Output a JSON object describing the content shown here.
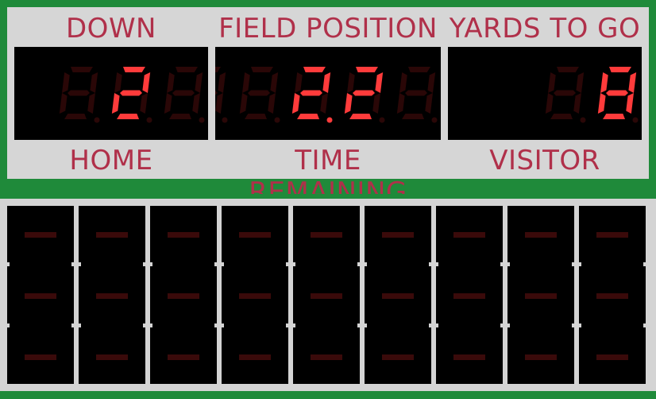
{
  "labels": {
    "down": "DOWN",
    "field_position": "FIELD POSITION",
    "yards_to_go": "YARDS TO GO",
    "home": "HOME",
    "time_remaining": "TIME REMAINING",
    "visitor": "VISITOR"
  },
  "displays": {
    "down": {
      "value": "2",
      "digits": [
        "8",
        "2",
        "8"
      ]
    },
    "field_position": {
      "value": "22",
      "digits": [
        "8",
        "8",
        "2",
        "2",
        "8"
      ]
    },
    "yards_to_go": {
      "value": "8",
      "digits": [
        "8",
        "8"
      ]
    }
  },
  "colors": {
    "lit": "#ff3b3b",
    "unlit": "#2a0707",
    "label": "#b0304a",
    "frame": "#1f8a3a",
    "panel": "#d6d6d6"
  },
  "board": {
    "columns": 9,
    "rows": 3,
    "cell_state": "blank"
  }
}
